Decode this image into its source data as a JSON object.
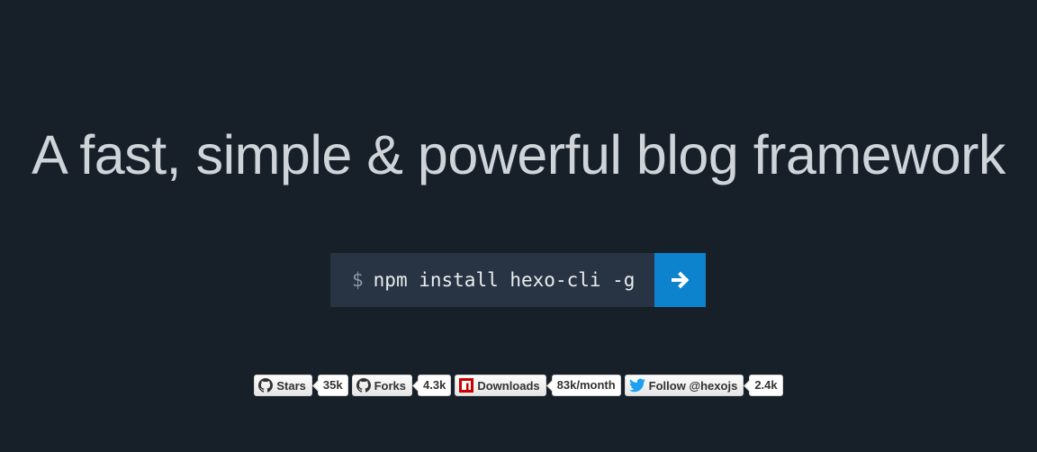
{
  "hero": {
    "title": "A fast, simple & powerful blog framework"
  },
  "install": {
    "prompt": "$",
    "command": "npm install hexo-cli -g",
    "button_icon": "arrow-right-icon",
    "button_color": "#0e83cd"
  },
  "badges": [
    {
      "icon": "github-icon",
      "label": "Stars",
      "count": "35k"
    },
    {
      "icon": "github-icon",
      "label": "Forks",
      "count": "4.3k"
    },
    {
      "icon": "npm-icon",
      "label": "Downloads",
      "count": "83k/month"
    },
    {
      "icon": "twitter-icon",
      "label": "Follow @hexojs",
      "count": "2.4k"
    }
  ],
  "colors": {
    "background": "#171f29",
    "command_bg": "#283443",
    "title_text": "#cfd4d9",
    "npm_red": "#cb0000",
    "twitter_blue": "#1da1f2"
  }
}
